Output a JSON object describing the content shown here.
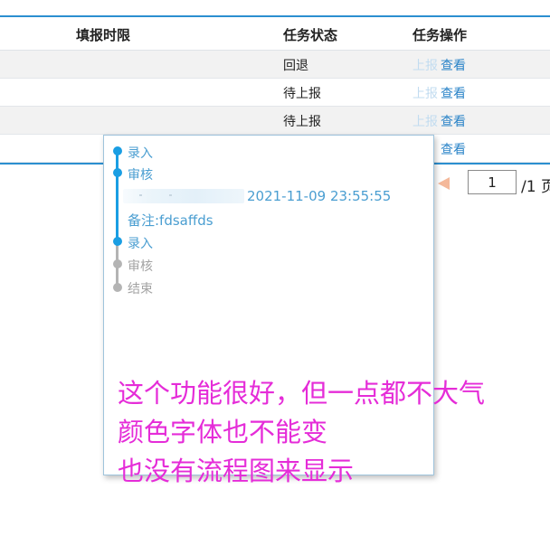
{
  "table": {
    "headers": {
      "fill_time": "填报时限",
      "task_status": "任务状态",
      "task_ops": "任务操作"
    },
    "rows": [
      {
        "status": "回退",
        "report": "上报",
        "view": "查看"
      },
      {
        "status": "待上报",
        "report": "上报",
        "view": "查看"
      },
      {
        "status": "待上报",
        "report": "上报",
        "view": "查看"
      },
      {
        "status": "",
        "report": "",
        "view": "查看"
      }
    ]
  },
  "pager": {
    "current": "1",
    "total": "/1 页"
  },
  "popup": {
    "steps": [
      {
        "label": "录入",
        "state": "active"
      },
      {
        "label": "审核",
        "state": "active"
      },
      {
        "label": "录入",
        "state": "active"
      },
      {
        "label": "审核",
        "state": "pending"
      },
      {
        "label": "结束",
        "state": "pending"
      }
    ],
    "review_time": "2021-11-09 23:55:55",
    "remark": "备注:fdsaffds"
  },
  "annotation": {
    "line1": "这个功能很好，但一点都不大气",
    "line2": "颜色字体也不能变",
    "line3": "也没有流程图来显示"
  },
  "colors": {
    "accent": "#2b8fd0",
    "timeline_active": "#1a9ee3",
    "timeline_pending": "#b4b4b4",
    "annotation": "#e52cd8",
    "link": "#2b84c8"
  }
}
